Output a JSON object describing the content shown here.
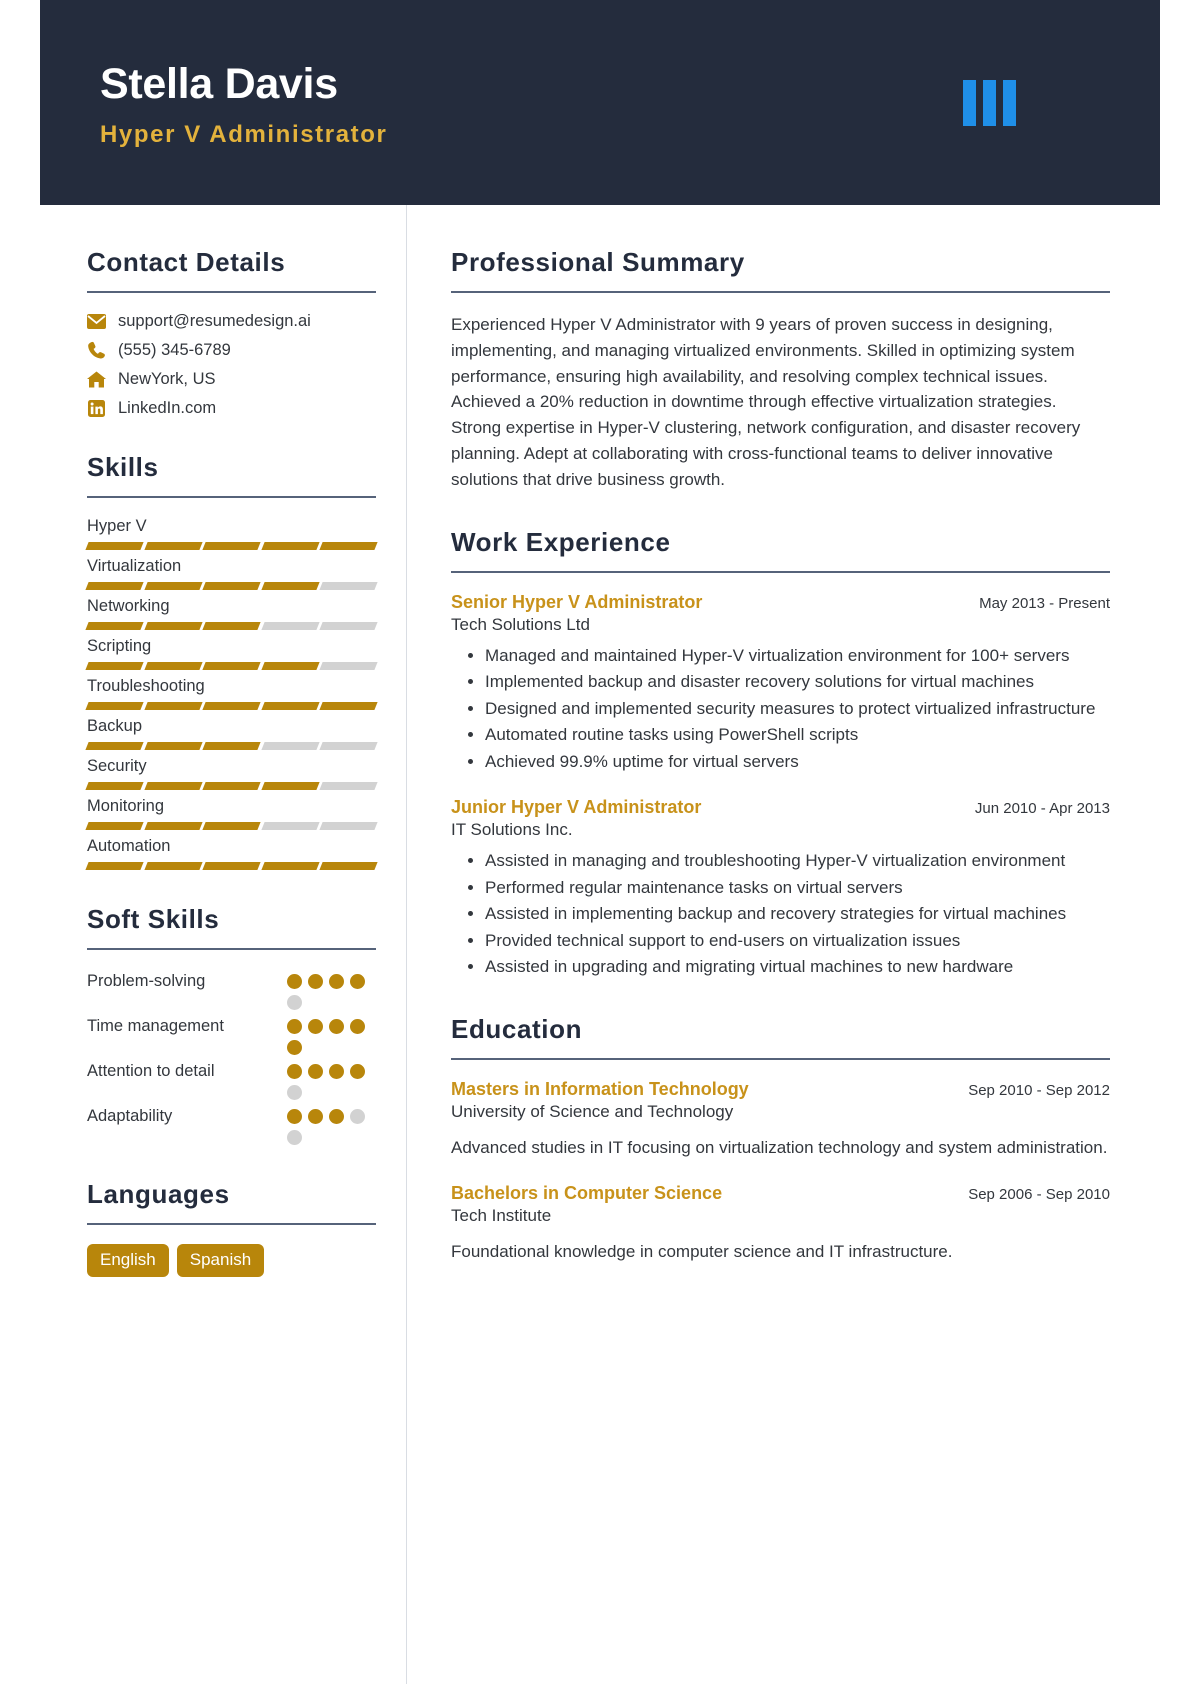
{
  "header": {
    "name": "Stella Davis",
    "title": "Hyper V Administrator",
    "logo_icon": "three-bars-logo",
    "bg_color": "#242c3d",
    "accent_color": "#e3b23c",
    "logo_color": "#1f8fe8"
  },
  "sidebar": {
    "contact": {
      "heading": "Contact Details",
      "items": [
        {
          "icon": "envelope-icon",
          "value": "support@resumedesign.ai"
        },
        {
          "icon": "phone-icon",
          "value": "(555) 345-6789"
        },
        {
          "icon": "home-icon",
          "value": "NewYork, US"
        },
        {
          "icon": "linkedin-icon",
          "value": "LinkedIn.com"
        }
      ]
    },
    "skills": {
      "heading": "Skills",
      "max_level": 5,
      "items": [
        {
          "name": "Hyper V",
          "level": 5
        },
        {
          "name": "Virtualization",
          "level": 4
        },
        {
          "name": "Networking",
          "level": 3
        },
        {
          "name": "Scripting",
          "level": 4
        },
        {
          "name": "Troubleshooting",
          "level": 5
        },
        {
          "name": "Backup",
          "level": 3
        },
        {
          "name": "Security",
          "level": 4
        },
        {
          "name": "Monitoring",
          "level": 3
        },
        {
          "name": "Automation",
          "level": 5
        }
      ]
    },
    "soft_skills": {
      "heading": "Soft Skills",
      "max_level": 5,
      "items": [
        {
          "name": "Problem-solving",
          "level": 4
        },
        {
          "name": "Time management",
          "level": 5
        },
        {
          "name": "Attention to detail",
          "level": 4
        },
        {
          "name": "Adaptability",
          "level": 3
        }
      ]
    },
    "languages": {
      "heading": "Languages",
      "items": [
        "English",
        "Spanish"
      ]
    }
  },
  "main": {
    "summary": {
      "heading": "Professional Summary",
      "text": "Experienced Hyper V Administrator with 9 years of proven success in designing, implementing, and managing virtualized environments. Skilled in optimizing system performance, ensuring high availability, and resolving complex technical issues. Achieved a 20% reduction in downtime through effective virtualization strategies. Strong expertise in Hyper-V clustering, network configuration, and disaster recovery planning. Adept at collaborating with cross-functional teams to deliver innovative solutions that drive business growth."
    },
    "work": {
      "heading": "Work Experience",
      "entries": [
        {
          "title": "Senior Hyper V Administrator",
          "date": "May 2013 - Present",
          "org": "Tech Solutions Ltd",
          "bullets": [
            "Managed and maintained Hyper-V virtualization environment for 100+ servers",
            "Implemented backup and disaster recovery solutions for virtual machines",
            "Designed and implemented security measures to protect virtualized infrastructure",
            "Automated routine tasks using PowerShell scripts",
            "Achieved 99.9% uptime for virtual servers"
          ]
        },
        {
          "title": "Junior Hyper V Administrator",
          "date": "Jun 2010 - Apr 2013",
          "org": "IT Solutions Inc.",
          "bullets": [
            "Assisted in managing and troubleshooting Hyper-V virtualization environment",
            "Performed regular maintenance tasks on virtual servers",
            "Assisted in implementing backup and recovery strategies for virtual machines",
            "Provided technical support to end-users on virtualization issues",
            "Assisted in upgrading and migrating virtual machines to new hardware"
          ]
        }
      ]
    },
    "education": {
      "heading": "Education",
      "entries": [
        {
          "title": "Masters in Information Technology",
          "date": "Sep 2010 - Sep 2012",
          "org": "University of Science and Technology",
          "desc": "Advanced studies in IT focusing on virtualization technology and system administration."
        },
        {
          "title": "Bachelors in Computer Science",
          "date": "Sep 2006 - Sep 2010",
          "org": "Tech Institute",
          "desc": "Foundational knowledge in computer science and IT infrastructure."
        }
      ]
    }
  }
}
